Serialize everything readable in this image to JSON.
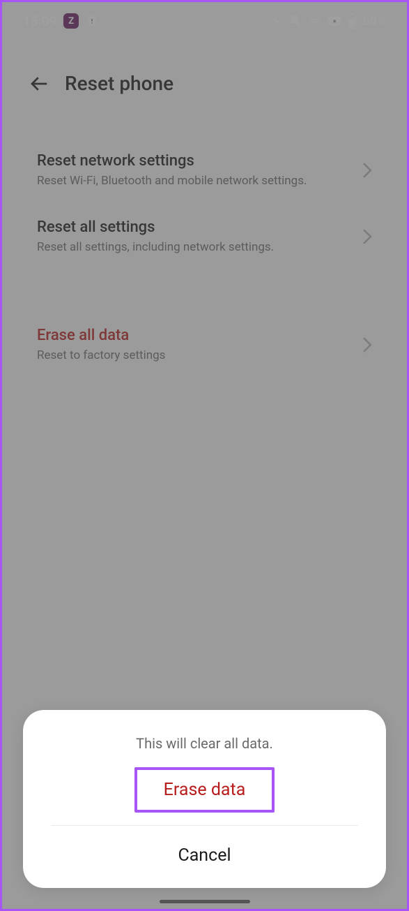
{
  "status": {
    "time": "15:09",
    "app_badge": "Z",
    "battery": "68%"
  },
  "header": {
    "title": "Reset phone"
  },
  "groups": [
    {
      "items": [
        {
          "title": "Reset network settings",
          "sub": "Reset Wi-Fi, Bluetooth and mobile network settings.",
          "danger": false
        },
        {
          "title": "Reset all settings",
          "sub": "Reset all settings, including network settings.",
          "danger": false
        }
      ]
    },
    {
      "items": [
        {
          "title": "Erase all data",
          "sub": "Reset to factory settings",
          "danger": true
        }
      ]
    }
  ],
  "dialog": {
    "message": "This will clear all data.",
    "confirm": "Erase data",
    "cancel": "Cancel"
  }
}
